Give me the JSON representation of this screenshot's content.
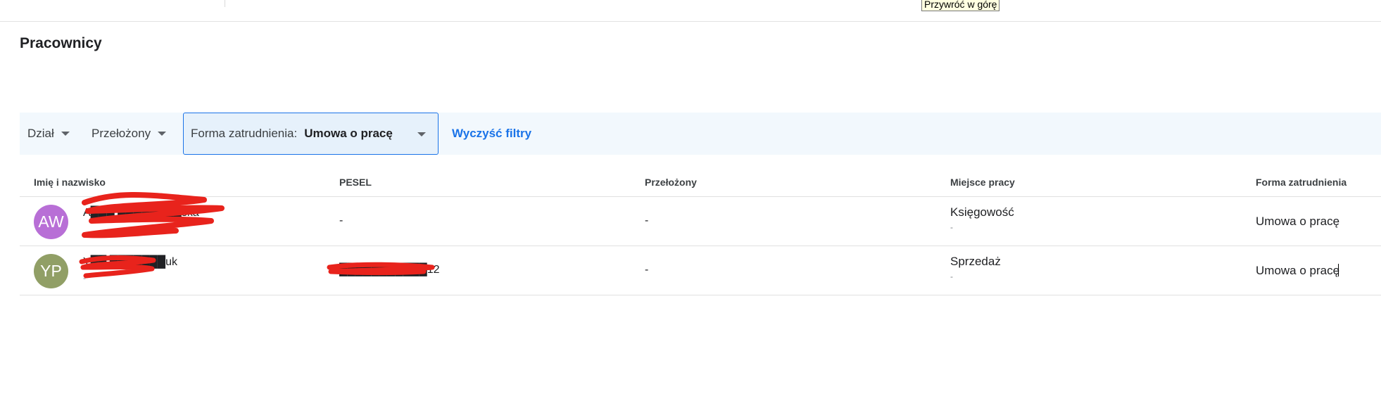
{
  "tooltip": "Przywróć w górę",
  "page": {
    "title": "Pracownicy"
  },
  "filters": {
    "dzial_label": "Dział",
    "przelozony_label": "Przełożony",
    "forma_label": "Forma zatrudnienia:",
    "forma_value": "Umowa o pracę",
    "clear_label": "Wyczyść filtry"
  },
  "table": {
    "columns": [
      "Imię i nazwisko",
      "PESEL",
      "Przełożony",
      "Miejsce pracy",
      "Forma zatrudnienia"
    ],
    "rows": [
      {
        "initials": "AW",
        "avatar_color": "#b86fd6",
        "name": "A███ ████████ska",
        "name_sub": "",
        "pesel": "-",
        "przelozony": "-",
        "miejsce": "Księgowość",
        "miejsce_sub": "-",
        "forma": "Umowa o pracę"
      },
      {
        "initials": "YP",
        "avatar_color": "#919f66",
        "name": "Y██ ███████uk",
        "name_sub": "-",
        "pesel": "███████████12",
        "przelozony": "-",
        "miejsce": "Sprzedaż",
        "miejsce_sub": "-",
        "forma": "Umowa o pracę"
      }
    ]
  },
  "colors": {
    "accent": "#1a73e8",
    "filter_bar_bg": "#f2f8fd",
    "redaction": "#e8231c"
  }
}
